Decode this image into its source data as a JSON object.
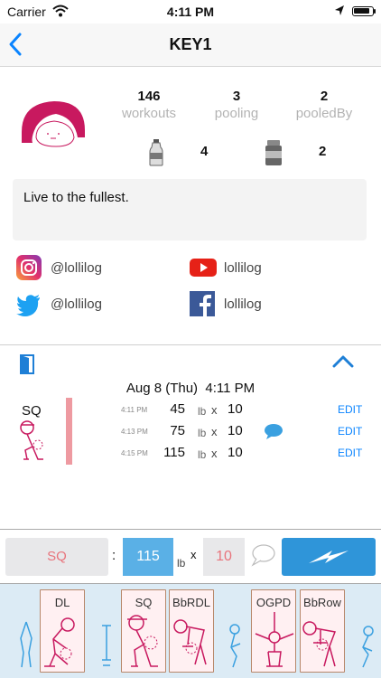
{
  "status_bar": {
    "carrier": "Carrier",
    "time": "4:11 PM"
  },
  "nav": {
    "title": "KEY1"
  },
  "profile": {
    "stats": [
      {
        "value": "146",
        "label": "workouts"
      },
      {
        "value": "3",
        "label": "pooling"
      },
      {
        "value": "2",
        "label": "pooledBy"
      }
    ],
    "bottle_count": "4",
    "jar_count": "2",
    "bio": "Live to the fullest."
  },
  "social": {
    "instagram": "@lollilog",
    "youtube": "lollilog",
    "twitter": "@lollilog",
    "facebook": "lollilog"
  },
  "workout": {
    "date": "Aug 8 (Thu)",
    "time": "4:11 PM",
    "exercise": "SQ",
    "unit": "lb",
    "times_sign": "x",
    "edit_label": "EDIT",
    "sets": [
      {
        "time": "4:11 PM",
        "weight": "45",
        "reps": "10"
      },
      {
        "time": "4:13 PM",
        "weight": "75",
        "reps": "10"
      },
      {
        "time": "4:15 PM",
        "weight": "115",
        "reps": "10"
      }
    ]
  },
  "input": {
    "exercise": "SQ",
    "colon": ":",
    "weight": "115",
    "unit": "lb",
    "times_sign": "x",
    "reps": "10"
  },
  "picker": {
    "cards": [
      "DL",
      "SQ",
      "BbRDL",
      "OGPD",
      "BbRow"
    ]
  },
  "colors": {
    "accent_blue": "#0a84ff",
    "pink": "#c8195f",
    "bar_pink": "#ee9aa1",
    "go_blue": "#2f95d9",
    "weight_blue": "#5ab0e6"
  }
}
